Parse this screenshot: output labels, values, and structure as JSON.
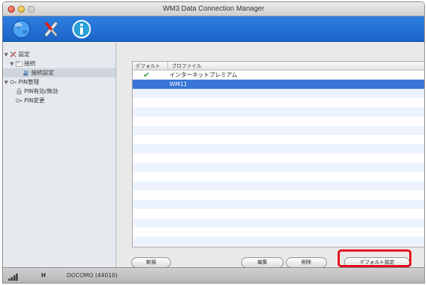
{
  "window": {
    "title": "WM3 Data Connection Manager"
  },
  "toolbar": {
    "icons": [
      {
        "name": "globe-icon",
        "label": ""
      },
      {
        "name": "tools-icon",
        "label": ""
      },
      {
        "name": "info-icon",
        "label": ""
      }
    ]
  },
  "sidebar": {
    "items": [
      {
        "label": "設定",
        "icon": "tools-icon",
        "level": 0
      },
      {
        "label": "接続",
        "icon": "folder-icon",
        "level": 1
      },
      {
        "label": "接続設定",
        "icon": "users-icon",
        "level": 2
      },
      {
        "label": "PIN管理",
        "icon": "key-icon",
        "level": 1
      },
      {
        "label": "PIN有効/無効",
        "icon": "lock-icon",
        "level": 2
      },
      {
        "label": "PIN変更",
        "icon": "key-icon",
        "level": 2
      }
    ]
  },
  "table": {
    "columns": [
      "デフォルト",
      "プロファイル"
    ],
    "rows": [
      {
        "default": "✔",
        "profile": "インターネットプレミアム"
      },
      {
        "default": "",
        "profile": "WM11"
      }
    ]
  },
  "buttons": {
    "new": "新規",
    "edit": "編集",
    "delete": "削除",
    "set_default": "デフォルト設定"
  },
  "statusbar": {
    "network_type": "",
    "h_indicator": "H",
    "carrier": "DOCOMO (44010)"
  },
  "colors": {
    "toolbar_blue": "#2d7fe0",
    "selection_blue": "#3875d7",
    "highlight_red": "#e60012"
  }
}
